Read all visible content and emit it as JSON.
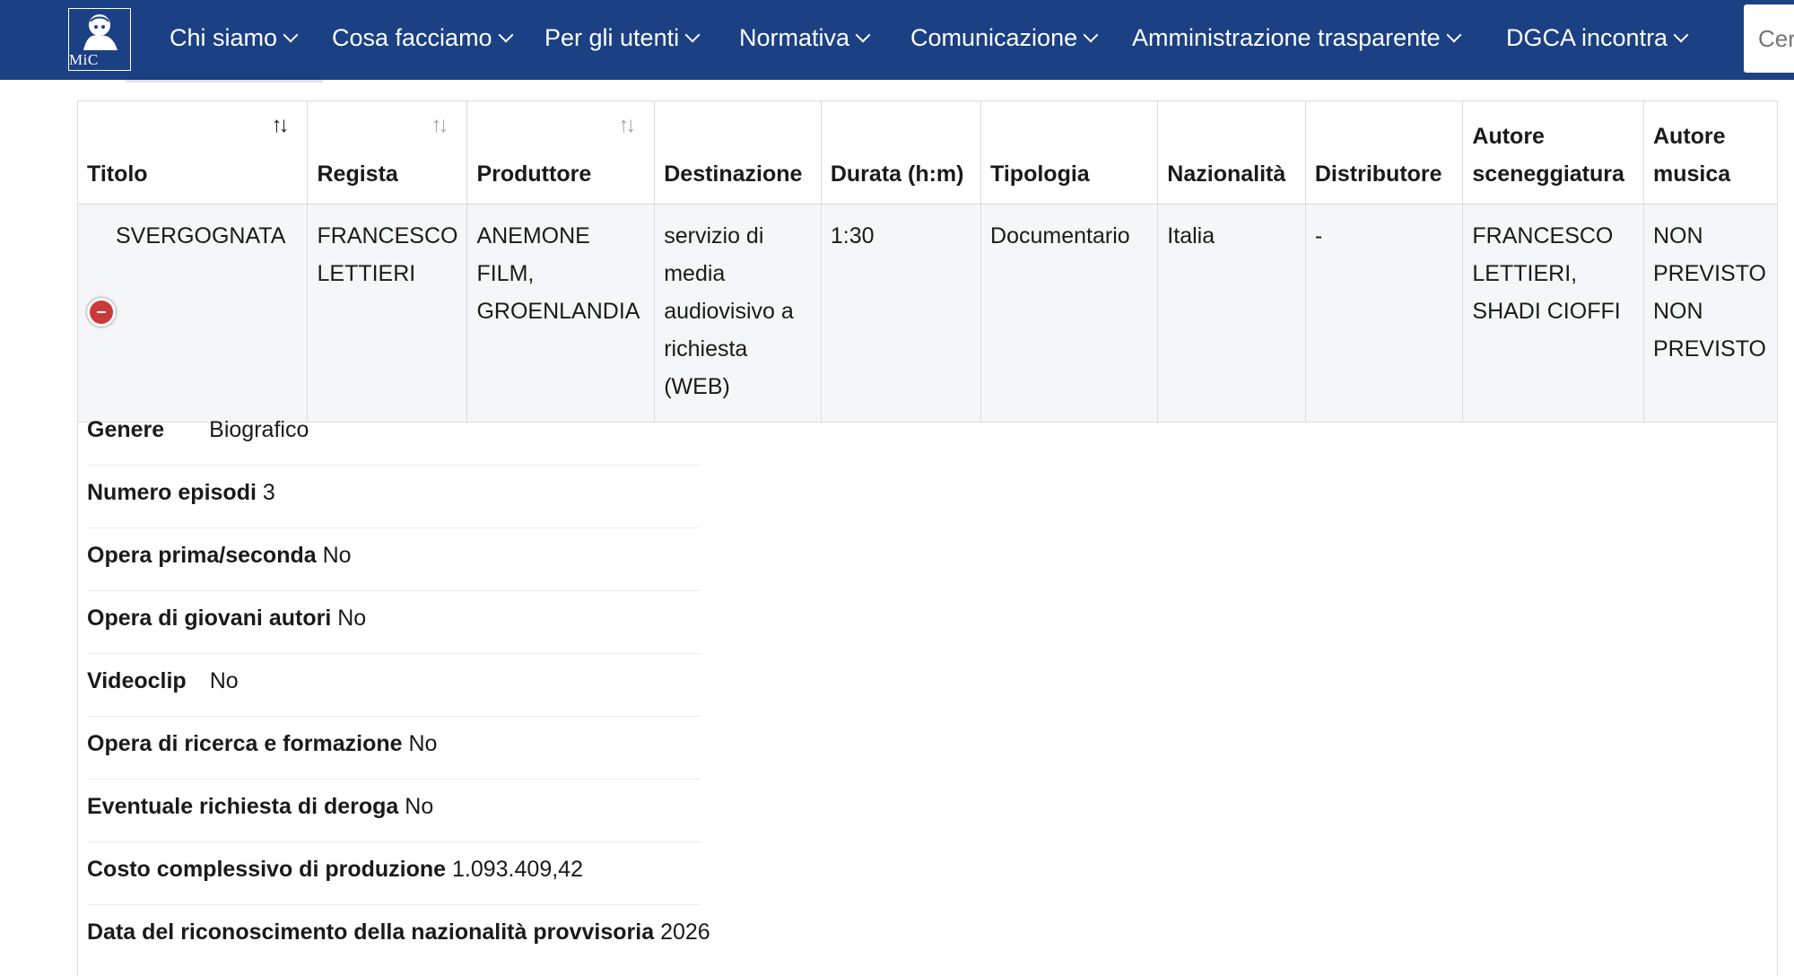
{
  "header": {
    "logo_text": "MiC",
    "nav": [
      {
        "label": "Chi siamo"
      },
      {
        "label": "Cosa facciamo"
      },
      {
        "label": "Per gli utenti"
      },
      {
        "label": "Normativa"
      },
      {
        "label": "Comunicazione"
      },
      {
        "label": "Amministrazione trasparente"
      },
      {
        "label": "DGCA incontra"
      }
    ],
    "search_placeholder": "Cerca"
  },
  "table": {
    "columns": [
      {
        "label": "Titolo",
        "sortable": true,
        "sort": "asc"
      },
      {
        "label": "Regista",
        "sortable": true
      },
      {
        "label": "Produttore",
        "sortable": true
      },
      {
        "label": "Destinazione"
      },
      {
        "label": "Durata (h:m)"
      },
      {
        "label": "Tipologia"
      },
      {
        "label": "Nazionalità"
      },
      {
        "label": "Distributore"
      },
      {
        "label": "Autore sceneggiatura"
      },
      {
        "label": "Autore musica"
      }
    ],
    "row": {
      "titolo": "SVERGOGNATA",
      "regista": "FRANCESCO LETTIERI",
      "produttore": "ANEMONE FILM, GROENLANDIA",
      "destinazione": "servizio di media audiovisivo a richiesta (WEB)",
      "durata": "1:30",
      "tipologia": "Documentario",
      "nazionalita": "Italia",
      "distributore": "-",
      "autore_sceneggiatura": "FRANCESCO LETTIERI, SHADI CIOFFI",
      "autore_musica": "NON PREVISTO NON PREVISTO"
    }
  },
  "details": [
    {
      "label": "Genere",
      "value": "Biografico"
    },
    {
      "label": "Numero episodi",
      "value": "3"
    },
    {
      "label": "Opera prima/seconda",
      "value": "No"
    },
    {
      "label": "Opera di giovani autori",
      "value": "No"
    },
    {
      "label": "Videoclip",
      "value": "No"
    },
    {
      "label": "Opera di ricerca e formazione",
      "value": "No"
    },
    {
      "label": "Eventuale richiesta di deroga",
      "value": "No"
    },
    {
      "label": "Costo complessivo di produzione",
      "value": "1.093.409,42"
    },
    {
      "label": "Data del riconoscimento della nazionalità provvisoria",
      "value": "2026"
    }
  ],
  "colors": {
    "header_bg": "#1b4083",
    "row_bg": "#f5f6f8",
    "collapse_button": "#cc3a37"
  },
  "icons": [
    "mic-logo",
    "chevron-down-icon",
    "sort-icon",
    "collapse-row-icon"
  ]
}
